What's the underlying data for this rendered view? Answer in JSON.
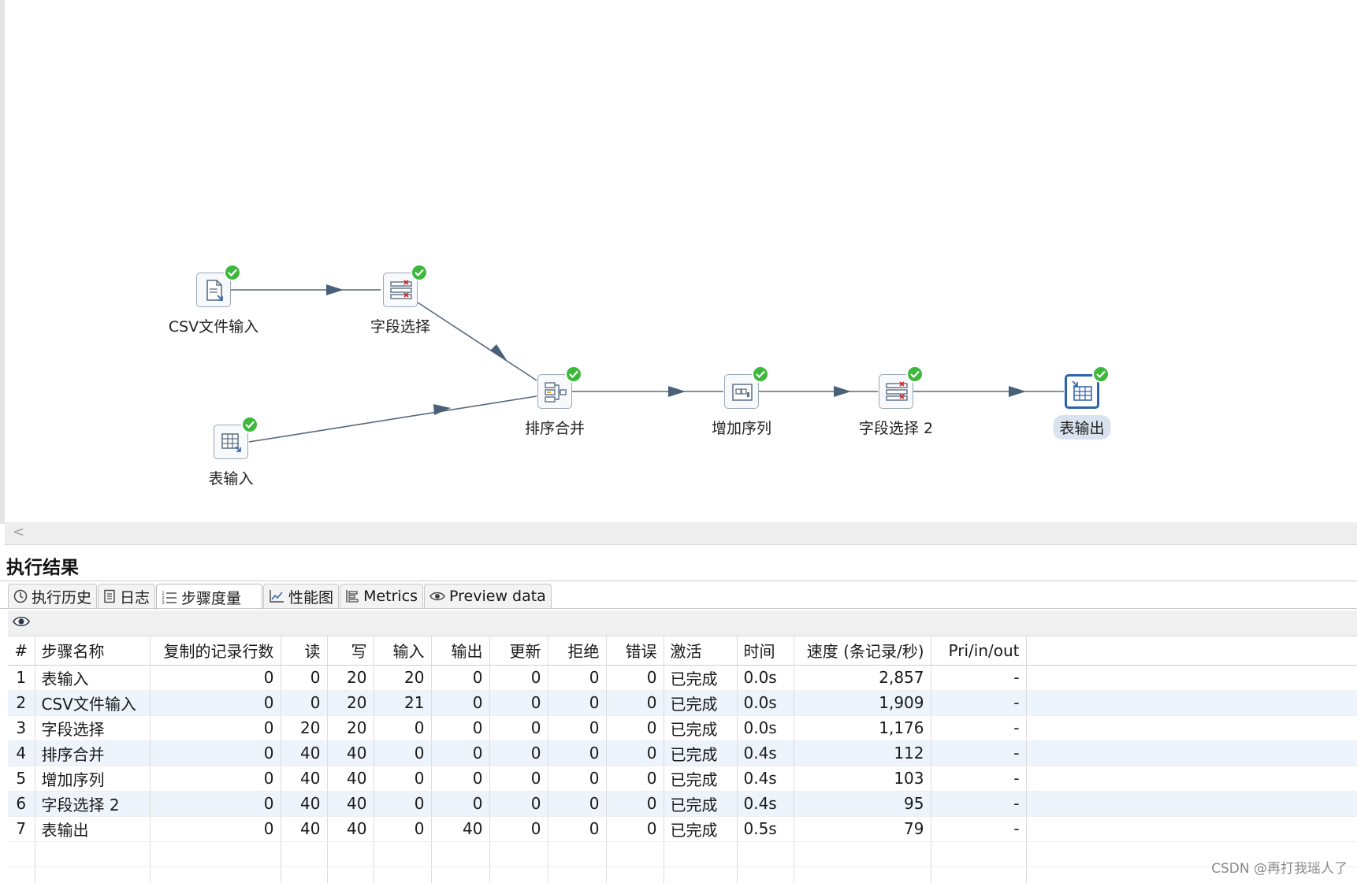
{
  "canvas": {
    "nodes": {
      "csv_input": "CSV文件输入",
      "field_select": "字段选择",
      "table_input": "表输入",
      "sort_merge": "排序合并",
      "add_sequence": "增加序列",
      "field_select_2": "字段选择 2",
      "table_output": "表输出"
    },
    "scroll_left_glyph": "<"
  },
  "panel": {
    "title": "执行结果",
    "tabs": [
      {
        "label": "执行历史",
        "icon": "clock-icon"
      },
      {
        "label": "日志",
        "icon": "log-icon"
      },
      {
        "label": "步骤度量",
        "icon": "list-icon"
      },
      {
        "label": "性能图",
        "icon": "chart-icon"
      },
      {
        "label": "Metrics",
        "icon": "metrics-icon"
      },
      {
        "label": "Preview data",
        "icon": "eye-icon"
      }
    ],
    "active_tab": "步骤度量"
  },
  "table": {
    "headers": [
      "#",
      "步骤名称",
      "复制的记录行数",
      "读",
      "写",
      "输入",
      "输出",
      "更新",
      "拒绝",
      "错误",
      "激活",
      "时间",
      "速度 (条记录/秒)",
      "Pri/in/out"
    ],
    "rows": [
      [
        "1",
        "表输入",
        "0",
        "0",
        "20",
        "20",
        "0",
        "0",
        "0",
        "0",
        "已完成",
        "0.0s",
        "2,857",
        "-"
      ],
      [
        "2",
        "CSV文件输入",
        "0",
        "0",
        "20",
        "21",
        "0",
        "0",
        "0",
        "0",
        "已完成",
        "0.0s",
        "1,909",
        "-"
      ],
      [
        "3",
        "字段选择",
        "0",
        "20",
        "20",
        "0",
        "0",
        "0",
        "0",
        "0",
        "已完成",
        "0.0s",
        "1,176",
        "-"
      ],
      [
        "4",
        "排序合并",
        "0",
        "40",
        "40",
        "0",
        "0",
        "0",
        "0",
        "0",
        "已完成",
        "0.4s",
        "112",
        "-"
      ],
      [
        "5",
        "增加序列",
        "0",
        "40",
        "40",
        "0",
        "0",
        "0",
        "0",
        "0",
        "已完成",
        "0.4s",
        "103",
        "-"
      ],
      [
        "6",
        "字段选择 2",
        "0",
        "40",
        "40",
        "0",
        "0",
        "0",
        "0",
        "0",
        "已完成",
        "0.4s",
        "95",
        "-"
      ],
      [
        "7",
        "表输出",
        "0",
        "40",
        "40",
        "0",
        "40",
        "0",
        "0",
        "0",
        "已完成",
        "0.5s",
        "79",
        "-"
      ]
    ]
  },
  "watermark": "CSDN @再打我瑶人了"
}
